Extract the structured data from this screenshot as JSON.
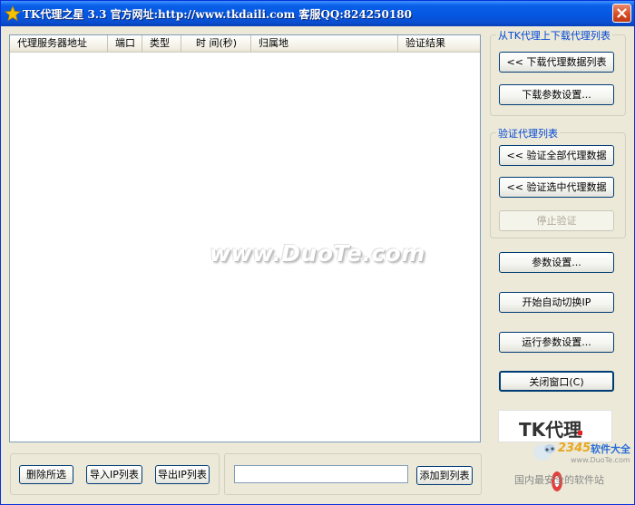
{
  "window": {
    "title": "TK代理之星 3.3 官方网址:http://www.tkdaili.com 客服QQ:824250180",
    "close_icon": "close-icon",
    "app_icon": "star-icon"
  },
  "table": {
    "columns": [
      "代理服务器地址",
      "端口",
      "类型",
      "时 间(秒)",
      "归属地",
      "验证结果"
    ],
    "rows": []
  },
  "watermark": "www.DuoTe.com",
  "download_group": {
    "legend": "从TK代理上下载代理列表",
    "download_button": "<< 下载代理数据列表",
    "params_button": "下载参数设置..."
  },
  "verify_group": {
    "legend": "验证代理列表",
    "verify_all_button": "<< 验证全部代理数据",
    "verify_selected_button": "<< 验证选中代理数据",
    "stop_button": "停止验证"
  },
  "actions": {
    "settings_button": "参数设置...",
    "auto_switch_button": "开始自动切换IP",
    "run_params_button": "运行参数设置...",
    "close_button": "关闭窗口(C)"
  },
  "bottom_left": {
    "delete_button": "删除所选",
    "import_button": "导入IP列表",
    "export_button": "导出IP列表"
  },
  "bottom_right": {
    "input_value": "",
    "add_button": "添加到列表"
  },
  "logo": {
    "text": "TK代理"
  },
  "site_badge": {
    "number": "2345",
    "name": "软件大全",
    "url": "www.DuoTe.com",
    "slogan": "国内最安全的软件站"
  },
  "colors": {
    "titlebar": "#0457e3",
    "window_bg": "#ece9d8",
    "legend": "#0046d5"
  }
}
